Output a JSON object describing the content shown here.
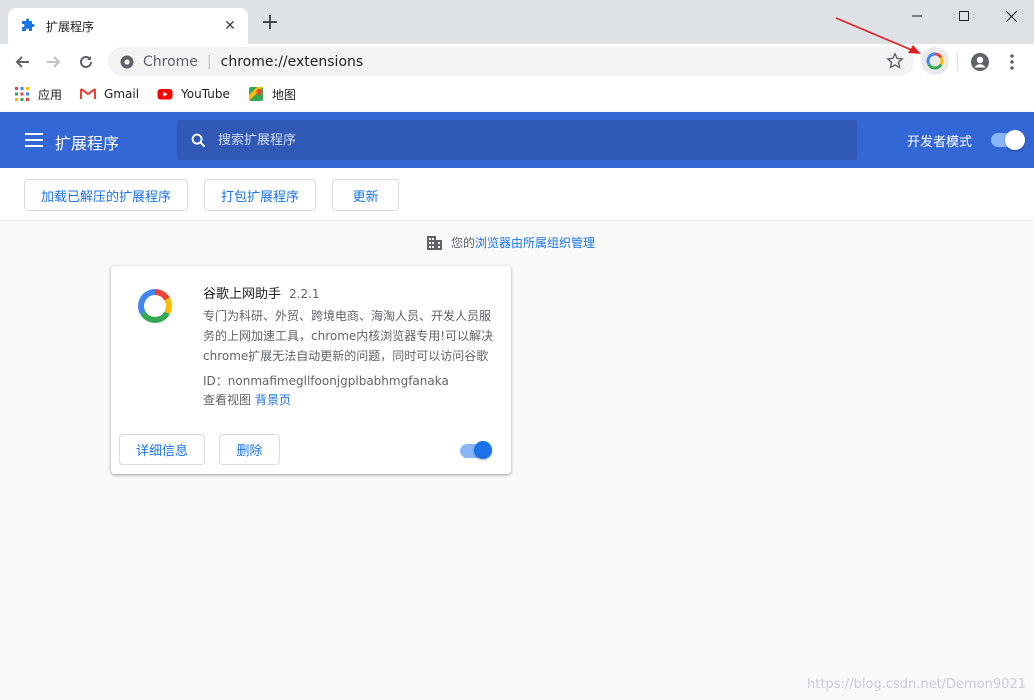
{
  "window": {
    "tab_title": "扩展程序",
    "close_tab_symbol": "✕",
    "new_tab_symbol": "+"
  },
  "toolbar": {
    "site_chip": "Chrome",
    "separator": "|",
    "url": "chrome://extensions"
  },
  "bookmarks": [
    {
      "label": "应用",
      "icon": "apps-grid-icon"
    },
    {
      "label": "Gmail",
      "icon": "gmail-icon"
    },
    {
      "label": "YouTube",
      "icon": "youtube-icon"
    },
    {
      "label": "地图",
      "icon": "maps-icon"
    }
  ],
  "ext_header": {
    "title": "扩展程序",
    "search_placeholder": "搜索扩展程序",
    "dev_mode_label": "开发者模式",
    "dev_mode_on": true
  },
  "actions": {
    "load_unpacked": "加载已解压的扩展程序",
    "pack": "打包扩展程序",
    "update": "更新"
  },
  "managed": {
    "prefix": "您的",
    "link": "浏览器由所属组织管理"
  },
  "extension": {
    "name": "谷歌上网助手",
    "version": "2.2.1",
    "description": "专门为科研、外贸、跨境电商、海淘人员、开发人员服务的上网加速工具，chrome内核浏览器专用!可以解决chrome扩展无法自动更新的问题，同时可以访问谷歌搜索，gmail邮箱，google+等谷歌服务。",
    "id_label": "ID：",
    "id": "nonmafimegllfoonjgplbabhmgfanaka",
    "views_label": "查看视图",
    "views_link": "背景页",
    "details_button": "详细信息",
    "remove_button": "删除",
    "enabled": true
  },
  "colors": {
    "header_blue": "#3367d6",
    "link_blue": "#1a73e8",
    "toggle_knob": "#1a73e8",
    "toggle_track": "#8ab4f8"
  },
  "watermark": "https://blog.csdn.net/Demon9021"
}
